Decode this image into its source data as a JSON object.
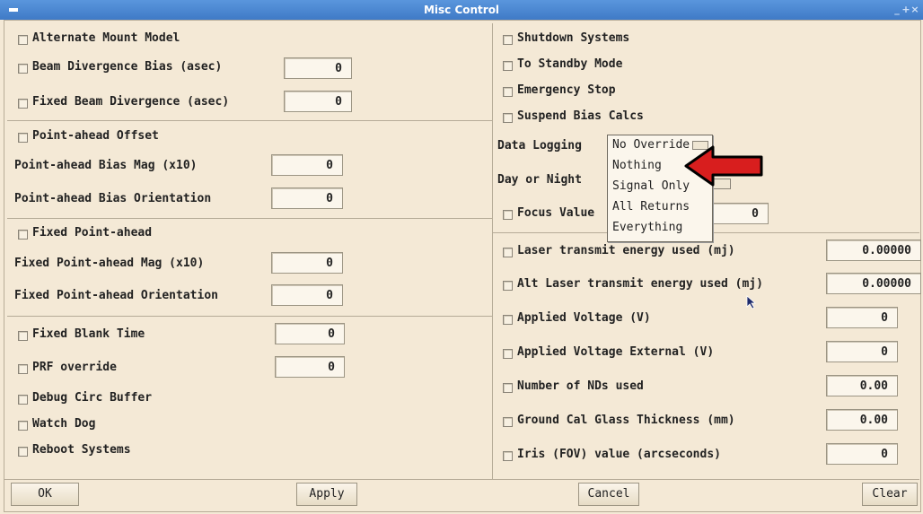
{
  "window": {
    "title": "Misc Control"
  },
  "left": {
    "alternate_mount": "Alternate Mount Model",
    "beam_div_bias": {
      "label": "Beam Divergence Bias  (asec)",
      "value": "0"
    },
    "fixed_beam_div": {
      "label": "Fixed Beam Divergence (asec)",
      "value": "0"
    },
    "point_ahead_offset": "Point-ahead Offset",
    "pa_bias_mag": {
      "label": "Point-ahead Bias Mag (x10)",
      "value": "0"
    },
    "pa_bias_orient": {
      "label": "Point-ahead Bias Orientation",
      "value": "0"
    },
    "fixed_point_ahead": "Fixed Point-ahead",
    "fpa_mag": {
      "label": "Fixed Point-ahead Mag (x10)",
      "value": "0"
    },
    "fpa_orient": {
      "label": "Fixed Point-ahead Orientation",
      "value": "0"
    },
    "fixed_blank": {
      "label": "Fixed Blank Time",
      "value": "0"
    },
    "prf_override": {
      "label": "PRF override",
      "value": "0"
    },
    "debug_circ": "Debug Circ Buffer",
    "watch_dog": "Watch Dog",
    "reboot": "Reboot Systems"
  },
  "right": {
    "shutdown": "Shutdown Systems",
    "standby": "To Standby Mode",
    "estop": "Emergency Stop",
    "suspend_bias": "Suspend Bias Calcs",
    "data_logging": {
      "label": "Data Logging",
      "selected": "No Override"
    },
    "day_night": {
      "label": "Day or Night"
    },
    "focus": {
      "label": "Focus Value",
      "value": "0"
    },
    "laser_energy": {
      "label": "Laser transmit energy used (mj)",
      "value": "0.00000"
    },
    "alt_laser_energy": {
      "label": "Alt Laser transmit energy used (mj)",
      "value": "0.00000"
    },
    "applied_voltage": {
      "label": "Applied Voltage (V)",
      "value": "0"
    },
    "applied_voltage_ext": {
      "label": "Applied Voltage External (V)",
      "value": "0"
    },
    "num_nds": {
      "label": "Number of NDs used",
      "value": "0.00"
    },
    "glass_thickness": {
      "label": "Ground Cal Glass Thickness (mm)",
      "value": "0.00"
    },
    "iris": {
      "label": "Iris (FOV) value (arcseconds)",
      "value": "0"
    }
  },
  "dropdown": {
    "options": [
      "No Override",
      "Nothing",
      "Signal Only",
      "All Returns",
      "Everything"
    ]
  },
  "buttons": {
    "ok": "OK",
    "apply": "Apply",
    "cancel": "Cancel",
    "clear": "Clear"
  },
  "annotation": {
    "arrow_color": "#d81e1e"
  }
}
